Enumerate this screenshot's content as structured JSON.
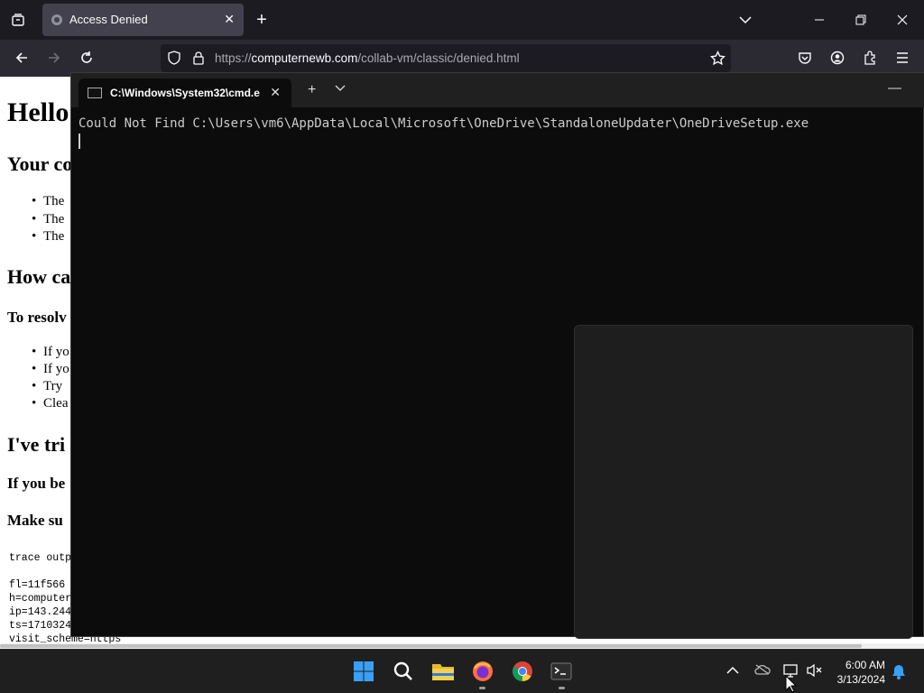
{
  "browser": {
    "tab_title": "Access Denied",
    "url_prefix": "https://",
    "url_host": "computernewb.com",
    "url_path": "/collab-vm/classic/denied.html"
  },
  "page": {
    "heading": "Hello",
    "subheading1": "Your co",
    "list1": [
      "The",
      "The",
      "The"
    ],
    "subheading2": "How ca",
    "resolve": "To resolv",
    "list2": [
      "If yo",
      "If yo",
      "Try",
      "Clea"
    ],
    "subheading3": "I've tri",
    "ifyou": "If you be",
    "makesure": "Make su",
    "trace": "trace outp",
    "trace_lines": [
      "fl=11f566",
      "h=computer",
      "ip=143.244",
      "ts=1710324",
      "visit_scheme=https"
    ]
  },
  "terminal": {
    "tab_title": "C:\\Windows\\System32\\cmd.e",
    "output": "Could Not Find C:\\Users\\vm6\\AppData\\Local\\Microsoft\\OneDrive\\StandaloneUpdater\\OneDriveSetup.exe"
  },
  "taskbar": {
    "time": "6:00 AM",
    "date": "3/13/2024"
  },
  "colors": {
    "accent_blue": "#0078d4",
    "terminal_bg": "#0c0c0c",
    "browser_tabstrip": "#1c1b22"
  }
}
